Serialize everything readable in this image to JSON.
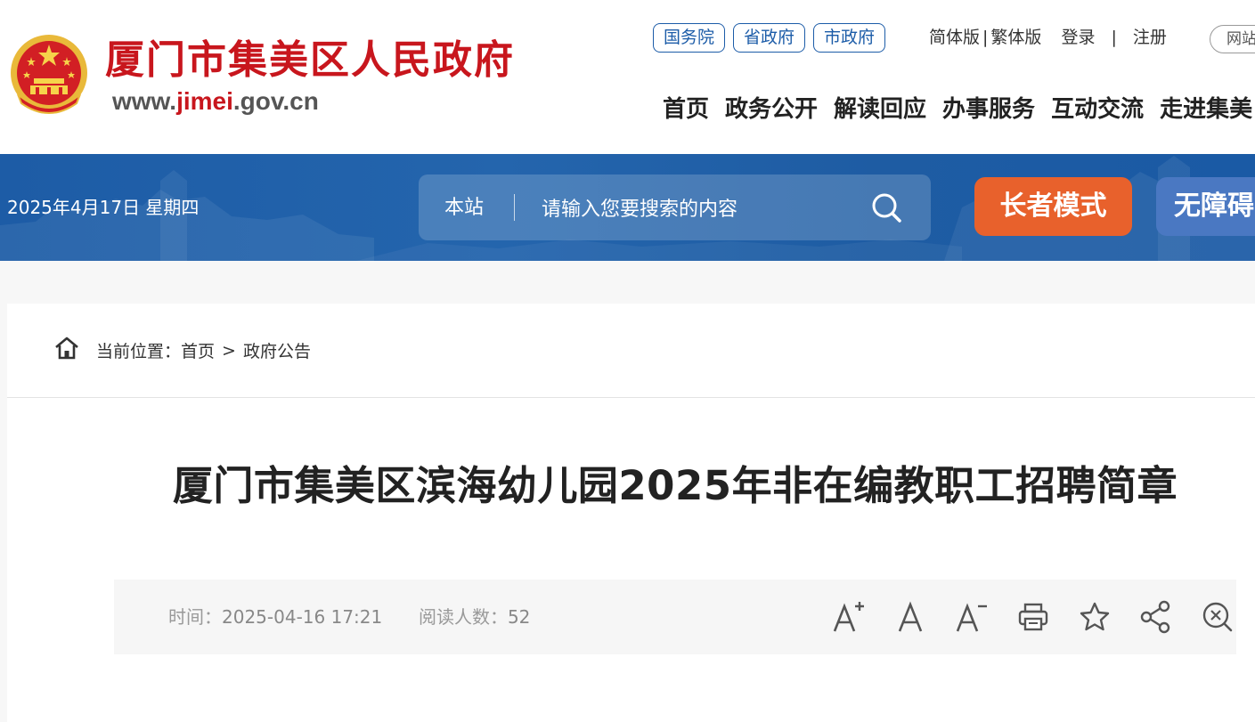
{
  "header": {
    "site_title": "厦门市集美区人民政府",
    "site_url_prefix": "www.",
    "site_url_highlight": "jimei",
    "site_url_suffix": ".gov.cn",
    "gov_links": [
      "国务院",
      "省政府",
      "市政府"
    ],
    "simplified_label": "简体版",
    "traditional_label": "繁体版",
    "login_label": "登录",
    "register_label": "注册",
    "pill_label": "网站",
    "nav": [
      "首页",
      "政务公开",
      "解读回应",
      "办事服务",
      "互动交流",
      "走进集美"
    ]
  },
  "banner": {
    "date": "2025年4月17日 星期四",
    "search_scope": "本站",
    "search_placeholder": "请输入您要搜索的内容",
    "elder_mode_label": "长者模式",
    "accessibility_label": "无障碍"
  },
  "breadcrumb": {
    "label": "当前位置：",
    "items": [
      "首页",
      "政府公告"
    ],
    "separator": ">"
  },
  "article": {
    "title": "厦门市集美区滨海幼儿园2025年非在编教职工招聘简章",
    "time_label": "时间：",
    "time_value": "2025-04-16 17:21",
    "readers_label": "阅读人数：",
    "readers_value": "52"
  },
  "colors": {
    "brand_red": "#c8161d",
    "brand_blue": "#1c5ca8",
    "elder_orange": "#e8612c",
    "access_blue": "#4a78c2"
  },
  "icons": [
    "national-emblem-icon",
    "search-icon",
    "home-icon",
    "font-larger-icon",
    "font-normal-icon",
    "font-smaller-icon",
    "print-icon",
    "star-icon",
    "share-icon",
    "close-zoom-icon"
  ]
}
